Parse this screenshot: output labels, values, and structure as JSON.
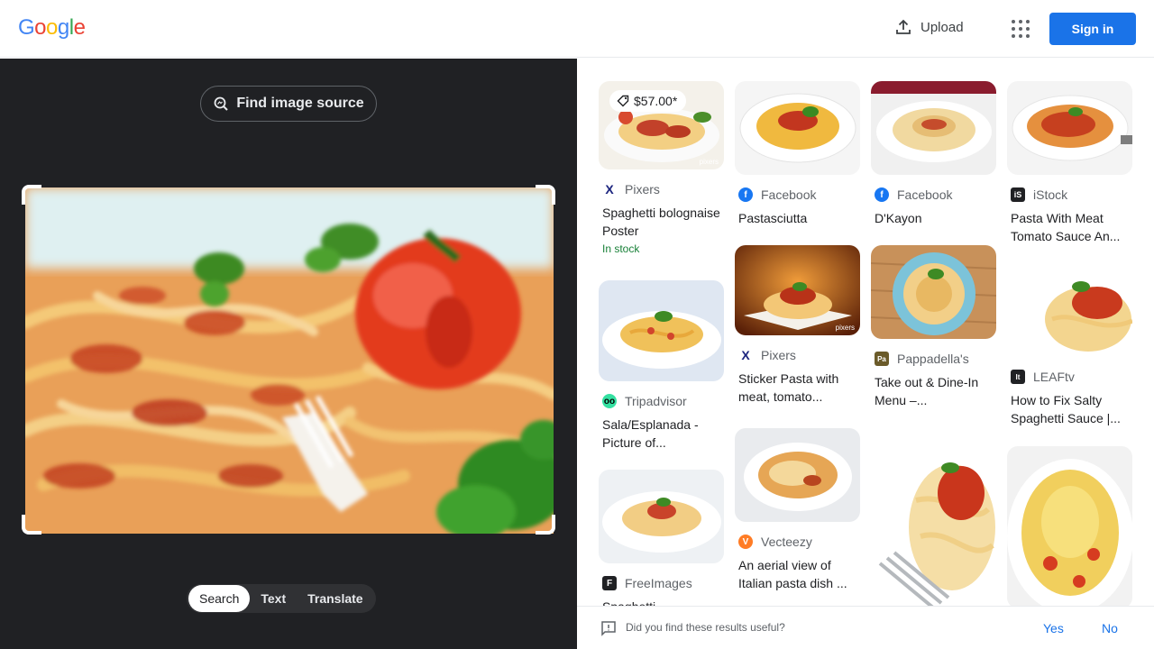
{
  "header": {
    "logo_letters": [
      "G",
      "o",
      "o",
      "g",
      "l",
      "e"
    ],
    "logo_colors": [
      "#4285f4",
      "#ea4335",
      "#fbbc05",
      "#4285f4",
      "#34a853",
      "#ea4335"
    ],
    "upload_label": "Upload",
    "signin_label": "Sign in"
  },
  "query": {
    "find_source_label": "Find image source",
    "modes": [
      "Search",
      "Text",
      "Translate"
    ],
    "active_mode": "Search"
  },
  "results": {
    "col1": [
      {
        "source": "Pixers",
        "favicon": "pixers-icon",
        "title": "Spaghetti bolognaise Poster",
        "price": "$57.00*",
        "availability": "In stock",
        "watermark": "pixers"
      },
      {
        "source": "Tripadvisor",
        "favicon": "tripadvisor-icon",
        "title": "Sala/Esplanada - Picture of..."
      },
      {
        "source": "FreeImages",
        "favicon": "freeimages-icon",
        "title": "Spaghetti..."
      }
    ],
    "col2": [
      {
        "source": "Facebook",
        "favicon": "facebook-icon",
        "title": "Pastasciutta"
      },
      {
        "source": "Pixers",
        "favicon": "pixers-icon",
        "title": "Sticker Pasta with meat, tomato...",
        "watermark": "pixers"
      },
      {
        "source": "Vecteezy",
        "favicon": "vecteezy-icon",
        "title": "An aerial view of Italian pasta dish ..."
      }
    ],
    "col3": [
      {
        "source": "Facebook",
        "favicon": "facebook-icon",
        "title": "D'Kayon"
      },
      {
        "source": "Pappadella's",
        "favicon": "pappadellas-icon",
        "title": "Take out & Dine-In Menu –..."
      },
      {
        "title": ""
      }
    ],
    "col4": [
      {
        "source": "iStock",
        "favicon": "istock-icon",
        "title": "Pasta With Meat Tomato Sauce An..."
      },
      {
        "source": "LEAFtv",
        "favicon": "leaftv-icon",
        "title": "How to Fix Salty Spaghetti Sauce |..."
      },
      {
        "title": ""
      }
    ]
  },
  "feedback": {
    "question": "Did you find these results useful?",
    "yes_label": "Yes",
    "no_label": "No"
  },
  "colors": {
    "accent": "#1a73e8",
    "dark_panel": "#202124",
    "in_stock": "#188038"
  }
}
